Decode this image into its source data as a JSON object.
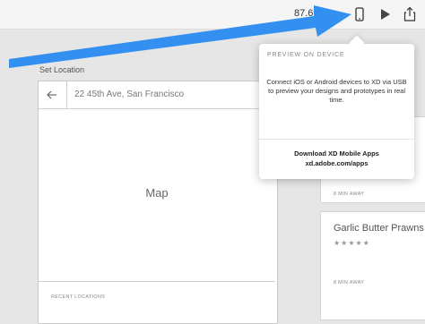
{
  "toolbar": {
    "zoom_level": "87.6%",
    "device_icon": "phone-icon",
    "play_icon": "play-icon",
    "share_icon": "share-icon"
  },
  "canvas": {
    "artboard_label": "Set Location",
    "search_value": "22 45th Ave, San Francisco",
    "map_label": "Map",
    "recent_label": "RECENT LOCATIONS"
  },
  "cards": [
    {
      "meta": "8 MIN AWAY"
    },
    {
      "title": "Garlic Butter Prawns",
      "rating": 5,
      "meta": "8 MIN AWAY"
    }
  ],
  "popover": {
    "heading": "PREVIEW ON DEVICE",
    "body": "Connect iOS or Android devices to XD via USB to preview your designs and prototypes in real time.",
    "link_title": "Download XD Mobile Apps",
    "link_url": "xd.adobe.com/apps"
  },
  "colors": {
    "annotation_arrow": "#2f8ef0",
    "canvas_bg": "#e6e6e6"
  }
}
